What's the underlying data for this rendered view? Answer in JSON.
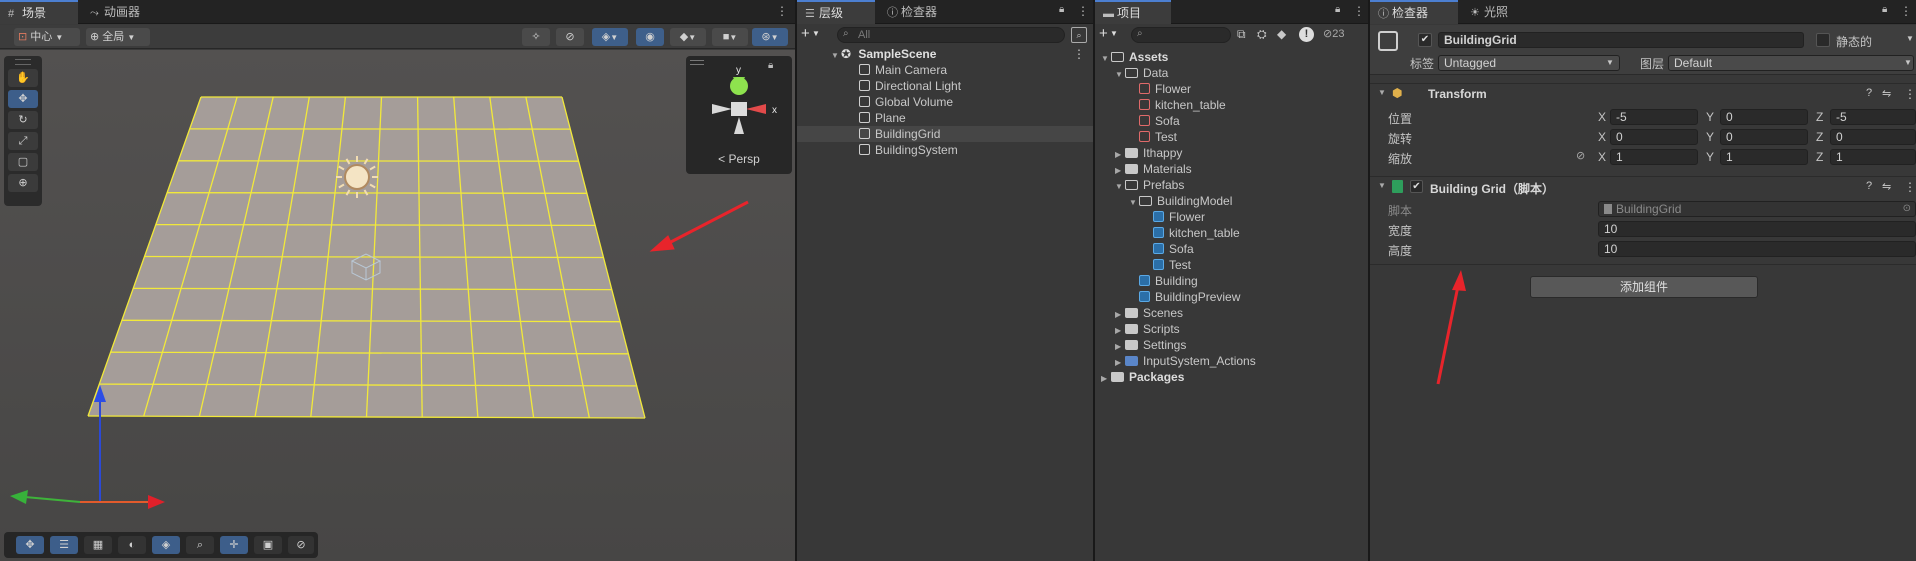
{
  "scene_panel": {
    "tabs": [
      {
        "label": "场景",
        "icon": "grid-icon"
      },
      {
        "label": "动画器",
        "icon": "animator-icon"
      }
    ],
    "pivot_label": "中心",
    "space_label": "全局",
    "gizmo_persp_label": "< Persp",
    "gizmo_axis_x": "x",
    "gizmo_axis_y": "y"
  },
  "hierarchy_panel": {
    "tabs": [
      {
        "label": "层级",
        "icon": "list-icon"
      },
      {
        "label": "检查器",
        "icon": "info-icon"
      }
    ],
    "search_placeholder": "All",
    "scene_name": "SampleScene",
    "items": [
      "Main Camera",
      "Directional Light",
      "Global Volume",
      "Plane",
      "BuildingGrid",
      "BuildingSystem"
    ],
    "selected_item": "BuildingGrid"
  },
  "project_panel": {
    "tabs": [
      {
        "label": "项目",
        "icon": "folder-icon"
      }
    ],
    "hidden_count": "23",
    "tree": [
      {
        "label": "Assets",
        "depth": 0,
        "type": "folder-open",
        "expanded": true
      },
      {
        "label": "Data",
        "depth": 1,
        "type": "folder-open",
        "expanded": true
      },
      {
        "label": "Flower",
        "depth": 2,
        "type": "scriptable"
      },
      {
        "label": "kitchen_table",
        "depth": 2,
        "type": "scriptable"
      },
      {
        "label": "Sofa",
        "depth": 2,
        "type": "scriptable"
      },
      {
        "label": "Test",
        "depth": 2,
        "type": "scriptable"
      },
      {
        "label": "Ithappy",
        "depth": 1,
        "type": "folder",
        "expanded": false
      },
      {
        "label": "Materials",
        "depth": 1,
        "type": "folder",
        "expanded": false
      },
      {
        "label": "Prefabs",
        "depth": 1,
        "type": "folder-open",
        "expanded": true
      },
      {
        "label": "BuildingModel",
        "depth": 2,
        "type": "folder-open",
        "expanded": true
      },
      {
        "label": "Flower",
        "depth": 3,
        "type": "prefab"
      },
      {
        "label": "kitchen_table",
        "depth": 3,
        "type": "prefab"
      },
      {
        "label": "Sofa",
        "depth": 3,
        "type": "prefab"
      },
      {
        "label": "Test",
        "depth": 3,
        "type": "prefab"
      },
      {
        "label": "Building",
        "depth": 2,
        "type": "prefab"
      },
      {
        "label": "BuildingPreview",
        "depth": 2,
        "type": "prefab"
      },
      {
        "label": "Scenes",
        "depth": 1,
        "type": "folder",
        "expanded": false
      },
      {
        "label": "Scripts",
        "depth": 1,
        "type": "folder",
        "expanded": false
      },
      {
        "label": "Settings",
        "depth": 1,
        "type": "folder",
        "expanded": false
      },
      {
        "label": "InputSystem_Actions",
        "depth": 1,
        "type": "input",
        "expanded": false
      },
      {
        "label": "Packages",
        "depth": 0,
        "type": "folder",
        "expanded": false
      }
    ]
  },
  "inspector_panel": {
    "tabs": [
      {
        "label": "检查器",
        "icon": "info-icon"
      },
      {
        "label": "光照",
        "icon": "light-icon"
      }
    ],
    "object_name": "BuildingGrid",
    "static_label": "静态的",
    "tag_label": "标签",
    "tag_value": "Untagged",
    "layer_label": "图层",
    "layer_value": "Default",
    "transform": {
      "title": "Transform",
      "position_label": "位置",
      "rotation_label": "旋转",
      "scale_label": "缩放",
      "position": {
        "x": "-5",
        "y": "0",
        "z": "-5"
      },
      "rotation": {
        "x": "0",
        "y": "0",
        "z": "0"
      },
      "scale": {
        "x": "1",
        "y": "1",
        "z": "1"
      },
      "axis_x": "X",
      "axis_y": "Y",
      "axis_z": "Z"
    },
    "building_grid": {
      "title": "Building Grid（脚本）",
      "script_label": "脚本",
      "script_value": "BuildingGrid",
      "width_label": "宽度",
      "width_value": "10",
      "height_label": "高度",
      "height_value": "10"
    },
    "add_component_label": "添加组件"
  },
  "colors": {
    "accent": "#4c7fd1",
    "grid_line": "#f2e93a",
    "plane": "#a59d99",
    "red_arrow": "#e8242b"
  }
}
